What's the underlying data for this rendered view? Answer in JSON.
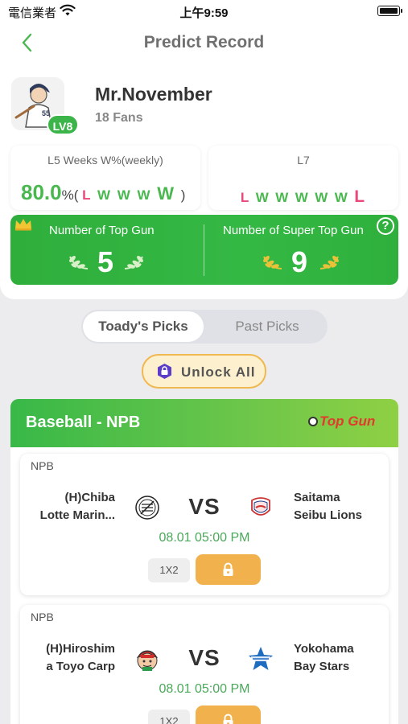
{
  "status_bar": {
    "carrier": "電信業者",
    "time": "上午9:59"
  },
  "nav": {
    "title": "Predict Record"
  },
  "profile": {
    "name": "Mr.November",
    "fans": "18 Fans",
    "level": "LV8",
    "jersey_number": "55"
  },
  "stats": {
    "l5": {
      "label": "L5 Weeks W%(weekly)",
      "percent": "80.0",
      "unit": "%(",
      "sequence": [
        "L",
        "W",
        "W",
        "W",
        "W"
      ],
      "close": ")"
    },
    "l7": {
      "label": "L7",
      "sequence": [
        "L",
        "W",
        "W",
        "W",
        "W",
        "W",
        "L"
      ]
    }
  },
  "top_gun": {
    "label": "Number of Top Gun",
    "value": "5"
  },
  "super_top_gun": {
    "label": "Number of Super Top Gun",
    "value": "9"
  },
  "tabs": {
    "today": "Toady's Picks",
    "past": "Past Picks"
  },
  "unlock_label": "Unlock All",
  "section": {
    "title": "Baseball - NPB",
    "badge": "Top Gun"
  },
  "matches": [
    {
      "league": "NPB",
      "home_line1": "(H)Chiba",
      "home_line2": "Lotte Marin...",
      "vs": "VS",
      "away_line1": "Saitama",
      "away_line2": "Seibu Lions",
      "time": "08.01 05:00 PM",
      "odds": "1X2"
    },
    {
      "league": "NPB",
      "home_line1": "(H)Hiroshim",
      "home_line2": "a Toyo Carp",
      "vs": "VS",
      "away_line1": "Yokohama",
      "away_line2": "Bay Stars",
      "time": "08.01 05:00 PM",
      "odds": "1X2"
    }
  ],
  "colors": {
    "green": "#3bb54a",
    "pink": "#e8487a",
    "orange": "#f1b14c",
    "time_green": "#4aa85a"
  }
}
